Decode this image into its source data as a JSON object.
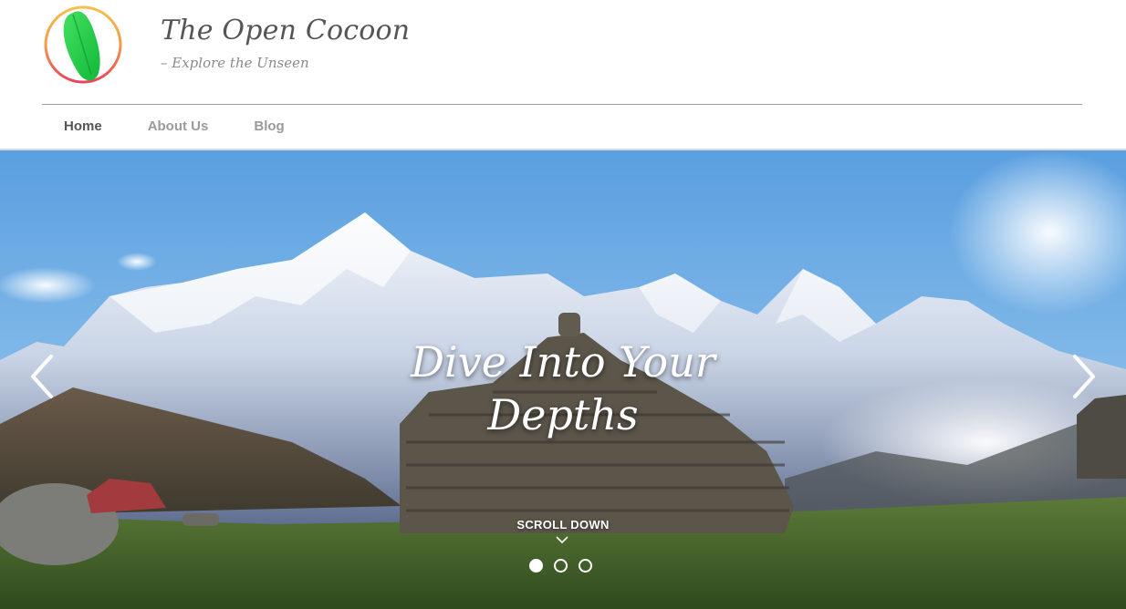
{
  "site": {
    "title": "The Open Cocoon",
    "tagline": "– Explore the Unseen",
    "logo_icon": "cocoon-logo-icon"
  },
  "nav": {
    "items": [
      {
        "label": "Home",
        "active": true
      },
      {
        "label": "About Us",
        "active": false
      },
      {
        "label": "Blog",
        "active": false
      }
    ]
  },
  "hero": {
    "headline_line1": "Dive Into Your",
    "headline_line2": "Depths",
    "scroll_label": "SCROLL DOWN",
    "slides": 3,
    "active_slide": 1,
    "prev_icon": "chevron-left-icon",
    "next_icon": "chevron-right-icon"
  },
  "colors": {
    "title": "#555555",
    "tagline": "#8a8a8a",
    "nav_active": "#555555",
    "nav_inactive": "#9a9a9a",
    "logo_green": "#22cc44",
    "logo_ring_start": "#f6c04d",
    "logo_ring_end": "#e8455a"
  }
}
